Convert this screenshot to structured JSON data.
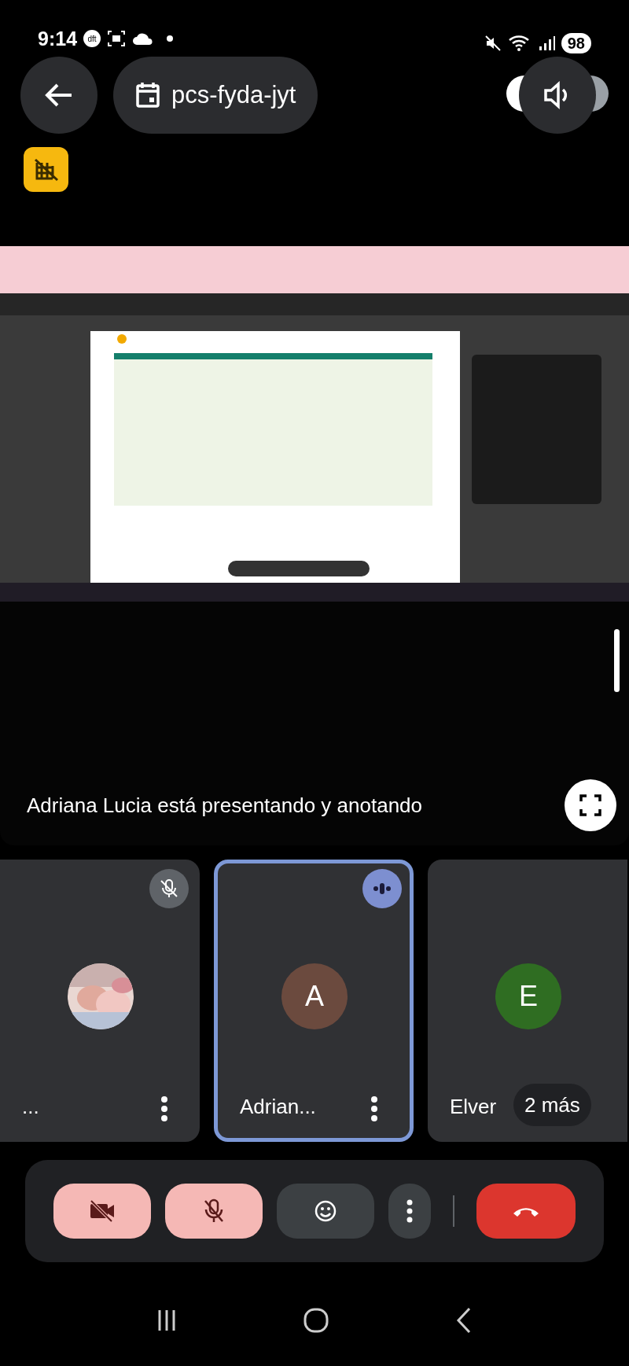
{
  "status_bar": {
    "time": "9:14",
    "badge": "dft",
    "battery": "98"
  },
  "meeting": {
    "code": "pcs-fyda-jyt"
  },
  "presenting": "Adriana Lucia está presentando y anotando",
  "participants": [
    {
      "kind": "picture",
      "name": "...",
      "muted": true,
      "speaking": false
    },
    {
      "kind": "initial",
      "initial": "A",
      "color": "#6b4a3e",
      "name": "Adrian...",
      "muted": false,
      "speaking": true
    },
    {
      "kind": "initial",
      "initial": "E",
      "color": "#2f6d22",
      "name": "Elver",
      "muted": false,
      "speaking": false
    }
  ],
  "more_participants": "2 más",
  "controls": {
    "camera_off": true,
    "mic_off": true
  }
}
